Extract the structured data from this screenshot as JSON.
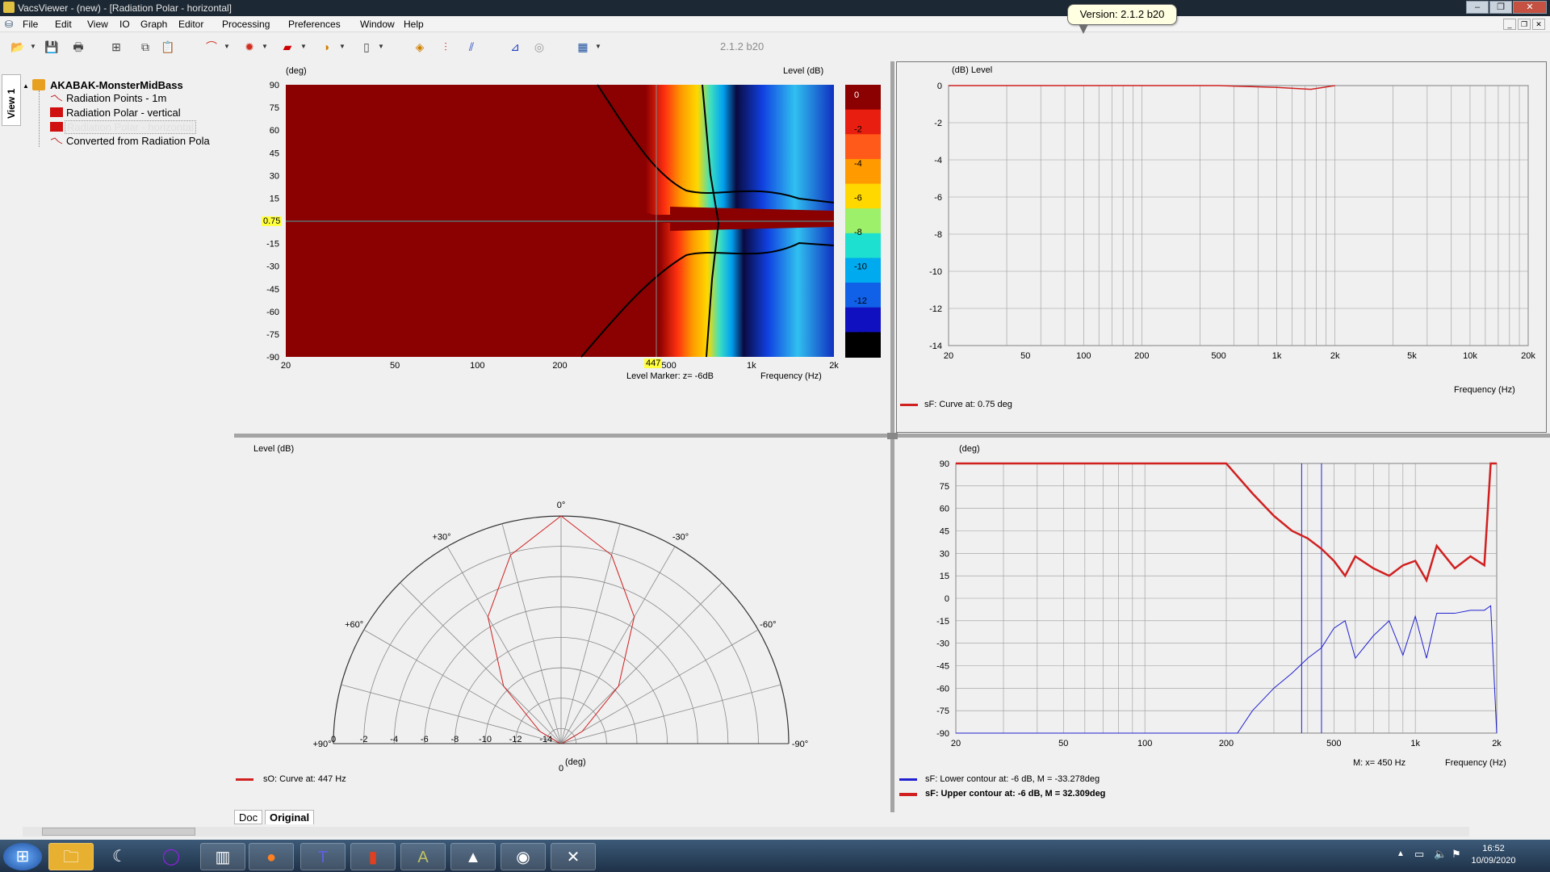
{
  "window": {
    "title": "VacsViewer - (new) - [Radiation Polar - horizontal]",
    "tooltip": "Version: 2.1.2 b20",
    "version_label": "2.1.2 b20"
  },
  "menu": [
    "File",
    "Edit",
    "View",
    "IO",
    "Graph",
    "Editor",
    "Processing",
    "Preferences",
    "Window",
    "Help"
  ],
  "toolbar_icons": [
    "open-icon",
    "save-icon",
    "print-icon",
    "tree-icon",
    "copy-icon",
    "paste-icon",
    "graph-icon",
    "polar-icon",
    "color-icon",
    "palette-icon",
    "page-icon",
    "chart-a-icon",
    "chart-b-icon",
    "chart-c-icon",
    "chart-d-icon",
    "chart-e-icon",
    "table-icon"
  ],
  "sidebar": {
    "tab": "View 1",
    "root": "AKABAK-MonsterMidBass",
    "items": [
      "Radiation Points - 1m",
      "Radiation Polar - vertical",
      "Radiation Polar - horizontal",
      "Converted from Radiation Pola"
    ]
  },
  "contour": {
    "y_unit": "(deg)",
    "z_unit": "Level  (dB)",
    "y_ticks": [
      "90",
      "75",
      "60",
      "45",
      "30",
      "15",
      "0",
      "-15",
      "-30",
      "-45",
      "-60",
      "-75",
      "-90"
    ],
    "x_ticks": [
      "20",
      "50",
      "100",
      "200",
      "500",
      "1k",
      "2k"
    ],
    "x_label": "Frequency  (Hz)",
    "marker_y": "0.75",
    "marker_x": "447",
    "level_marker": "Level Marker:  z= -6dB",
    "scale_ticks": [
      "0",
      "-2",
      "-4",
      "-6",
      "-8",
      "-10",
      "-12",
      "-14"
    ],
    "scale_colors": [
      "#8b0000",
      "#e81e10",
      "#ff5a1a",
      "#ff9a00",
      "#ffd800",
      "#9cf06a",
      "#1ee0d0",
      "#00aaee",
      "#1060e8",
      "#1010c0",
      "#000000"
    ]
  },
  "level_chart": {
    "y_unit": "(dB)  Level",
    "y_ticks": [
      "0",
      "-2",
      "-4",
      "-6",
      "-8",
      "-10",
      "-12",
      "-14"
    ],
    "x_ticks": [
      "20",
      "50",
      "100",
      "200",
      "500",
      "1k",
      "2k",
      "5k",
      "10k",
      "20k"
    ],
    "x_label": "Frequency  (Hz)",
    "legend": "sF: Curve at: 0.75 deg"
  },
  "polar": {
    "title": "Level  (dB)",
    "angle_labels": [
      "0°",
      "+30°",
      "-30°",
      "+60°",
      "-60°",
      "+90°",
      "-90°"
    ],
    "ring_ticks": [
      "0",
      "-2",
      "-4",
      "-6",
      "-8",
      "-10",
      "-12",
      "-14"
    ],
    "center_label": "0",
    "unit_label": "(deg)",
    "legend": "sO: Curve at: 447 Hz"
  },
  "contour_chart": {
    "y_unit": "(deg)",
    "y_ticks": [
      "90",
      "75",
      "60",
      "45",
      "30",
      "15",
      "0",
      "-15",
      "-30",
      "-45",
      "-60",
      "-75",
      "-90"
    ],
    "x_ticks": [
      "20",
      "50",
      "100",
      "200",
      "500",
      "1k",
      "2k"
    ],
    "x_label": "Frequency  (Hz)",
    "marker_readout": "M:  x= 450 Hz",
    "legend_lower": "sF: Lower contour at: -6 dB, M = -33.278deg",
    "legend_upper": "sF: Upper contour at: -6 dB, M = 32.309deg"
  },
  "bottom_tabs": [
    "Doc",
    "Original"
  ],
  "taskbar": {
    "apps": [
      "windows-start-icon",
      "explorer-icon",
      "app-fox-icon",
      "cortana-icon",
      "vacs-icon",
      "firefox-icon",
      "teams-icon",
      "archive-icon",
      "vacs-ab-icon",
      "triangle-app-icon",
      "camera-app-icon",
      "x-app-icon"
    ],
    "time": "16:52",
    "date": "10/09/2020"
  },
  "chart_data": [
    {
      "type": "heatmap",
      "title": "Radiation Polar - horizontal",
      "xlabel": "Frequency  (Hz)",
      "ylabel": "(deg)",
      "zlabel": "Level  (dB)",
      "xlim": [
        20,
        2000
      ],
      "ylim": [
        -90,
        90
      ],
      "zlim": [
        -14,
        0
      ],
      "xscale": "log"
    },
    {
      "type": "line",
      "xlabel": "Frequency  (Hz)",
      "ylabel": "Level (dB)",
      "xscale": "log",
      "xlim": [
        20,
        20000
      ],
      "ylim": [
        -14,
        0
      ],
      "series": [
        {
          "name": "sF: Curve at: 0.75 deg",
          "x": [
            20,
            100,
            500,
            1000,
            1500,
            2000
          ],
          "y": [
            0,
            0,
            0,
            -0.1,
            -0.2,
            0
          ]
        }
      ]
    },
    {
      "type": "line",
      "subtype": "polar",
      "title": "Level  (dB)",
      "frequency_label": "447 Hz",
      "rlim": [
        -14,
        0
      ],
      "series": [
        {
          "name": "sO: Curve at: 447 Hz",
          "theta": [
            -90,
            -75,
            -60,
            -45,
            -30,
            -15,
            0,
            15,
            30,
            45,
            60,
            75,
            90
          ],
          "r": [
            -14,
            -14,
            -12.5,
            -9,
            -5,
            -2,
            0,
            -2,
            -5,
            -9,
            -12.5,
            -14,
            -14
          ]
        }
      ]
    },
    {
      "type": "line",
      "xlabel": "Frequency  (Hz)",
      "ylabel": "(deg)",
      "xscale": "log",
      "xlim": [
        20,
        2000
      ],
      "ylim": [
        -90,
        90
      ],
      "series": [
        {
          "name": "sF: Upper contour at: -6 dB, M = 32.309deg",
          "x": [
            20,
            100,
            200,
            250,
            300,
            350,
            400,
            450,
            500,
            550,
            600,
            700,
            800,
            900,
            1000,
            1100,
            1200,
            1400,
            1600,
            1800,
            1900,
            2000
          ],
          "y": [
            90,
            90,
            90,
            70,
            55,
            45,
            40,
            33,
            25,
            15,
            28,
            20,
            15,
            22,
            25,
            12,
            35,
            20,
            28,
            22,
            90,
            90
          ]
        },
        {
          "name": "sF: Lower contour at: -6 dB, M = -33.278deg",
          "x": [
            20,
            200,
            220,
            250,
            300,
            350,
            400,
            450,
            500,
            550,
            600,
            700,
            800,
            900,
            1000,
            1100,
            1200,
            1400,
            1600,
            1800,
            1900,
            2000
          ],
          "y": [
            -90,
            -90,
            -90,
            -75,
            -60,
            -50,
            -40,
            -33,
            -20,
            -15,
            -40,
            -25,
            -15,
            -38,
            -12,
            -40,
            -10,
            -10,
            -8,
            -8,
            -5,
            -90
          ]
        }
      ]
    }
  ]
}
